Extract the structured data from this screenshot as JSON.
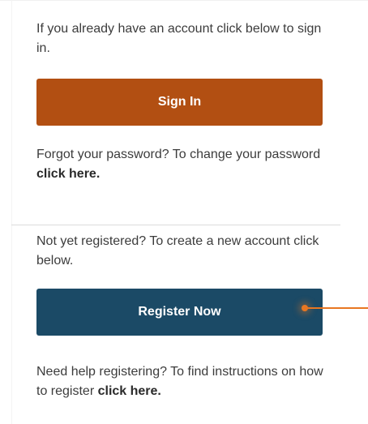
{
  "signin_section": {
    "intro": "If you already have an account click below to sign in.",
    "button_label": "Sign In",
    "forgot_prefix": "Forgot your password? To change your password ",
    "forgot_link": "click here."
  },
  "register_section": {
    "intro": "Not yet registered? To create a new account click below.",
    "button_label": "Register Now",
    "help_prefix": "Need help registering? To find instructions on how to register ",
    "help_link": "click here."
  },
  "colors": {
    "signin_button": "#b24f12",
    "register_button": "#1b4a66",
    "callout_accent": "#e87722"
  }
}
